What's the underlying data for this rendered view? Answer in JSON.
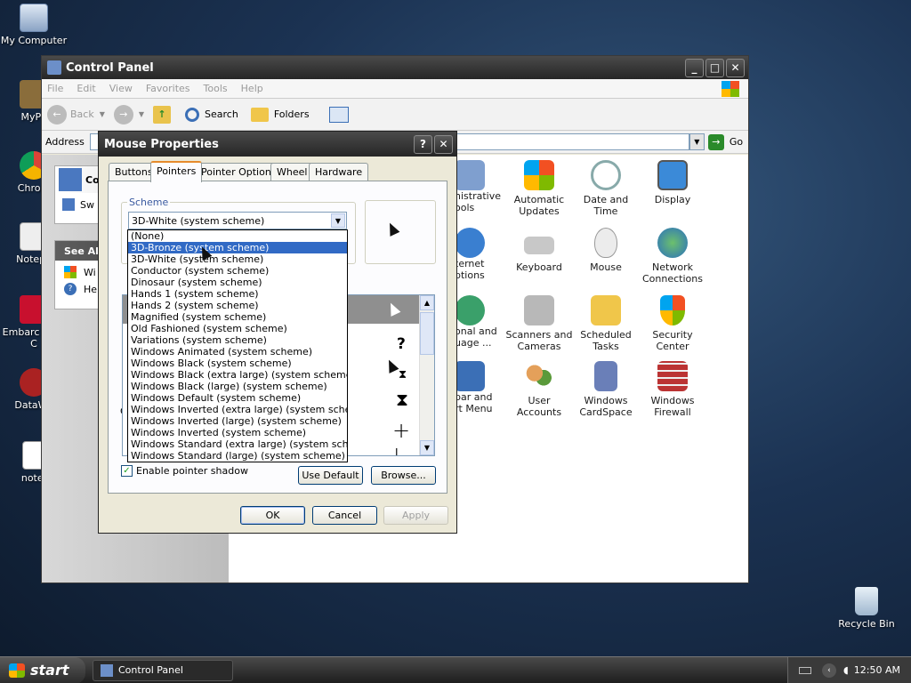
{
  "desktop": {
    "icons": [
      {
        "label": "My Computer"
      },
      {
        "label": "MyPa"
      },
      {
        "label": "Chrom"
      },
      {
        "label": "Notepa"
      },
      {
        "label": "Embarc Dev-C"
      },
      {
        "label": "DataWa"
      },
      {
        "label": "note."
      },
      {
        "label": "Recycle Bin"
      }
    ]
  },
  "control_panel": {
    "title": "Control Panel",
    "menu": [
      "File",
      "Edit",
      "View",
      "Favorites",
      "Tools",
      "Help"
    ],
    "toolbar": {
      "back": "Back",
      "search": "Search",
      "folders": "Folders"
    },
    "address": {
      "label": "Address",
      "go": "Go"
    },
    "sidebar": {
      "section1": "Con",
      "item1": "Sw",
      "section2": "See Al",
      "link1": "Wi",
      "link2": "He"
    },
    "items": [
      {
        "label": "nistrative ools"
      },
      {
        "label": "Automatic Updates"
      },
      {
        "label": "Date and Time"
      },
      {
        "label": "Display"
      },
      {
        "label": "ternet ptions"
      },
      {
        "label": "Keyboard"
      },
      {
        "label": "Mouse"
      },
      {
        "label": "Network Connections"
      },
      {
        "label": "onal and uage ..."
      },
      {
        "label": "Scanners and Cameras"
      },
      {
        "label": "Scheduled Tasks"
      },
      {
        "label": "Security Center"
      },
      {
        "label": "bar and rt Menu"
      },
      {
        "label": "User Accounts"
      },
      {
        "label": "Windows CardSpace"
      },
      {
        "label": "Windows Firewall"
      }
    ]
  },
  "mouse_props": {
    "title": "Mouse Properties",
    "help": "?",
    "tabs": [
      "Buttons",
      "Pointers",
      "Pointer Options",
      "Wheel",
      "Hardware"
    ],
    "scheme_label": "Scheme",
    "scheme_value": "3D-White (system scheme)",
    "customize_label": "C",
    "schemes": [
      "(None)",
      "3D-Bronze (system scheme)",
      "3D-White (system scheme)",
      "Conductor (system scheme)",
      "Dinosaur (system scheme)",
      "Hands 1 (system scheme)",
      "Hands 2 (system scheme)",
      "Magnified (system scheme)",
      "Old Fashioned (system scheme)",
      "Variations (system scheme)",
      "Windows Animated (system scheme)",
      "Windows Black  (system scheme)",
      "Windows Black (extra large) (system scheme)",
      "Windows Black (large) (system scheme)",
      "Windows Default (system scheme)",
      "Windows Inverted (extra large) (system scheme)",
      "Windows Inverted (large) (system scheme)",
      "Windows Inverted (system scheme)",
      "Windows Standard (extra large) (system scheme)",
      "Windows Standard (large) (system scheme)"
    ],
    "selected_scheme_index": 1,
    "shadow_label": "Enable pointer shadow",
    "shadow_checked": true,
    "use_default": "Use Default",
    "browse": "Browse...",
    "ok": "OK",
    "cancel": "Cancel",
    "apply": "Apply",
    "cursor_glyphs": {
      "help": "?",
      "busy": "⧗",
      "cross": "+",
      "text": "I"
    }
  },
  "taskbar": {
    "start": "start",
    "task": "Control Panel",
    "clock": "12:50 AM"
  }
}
